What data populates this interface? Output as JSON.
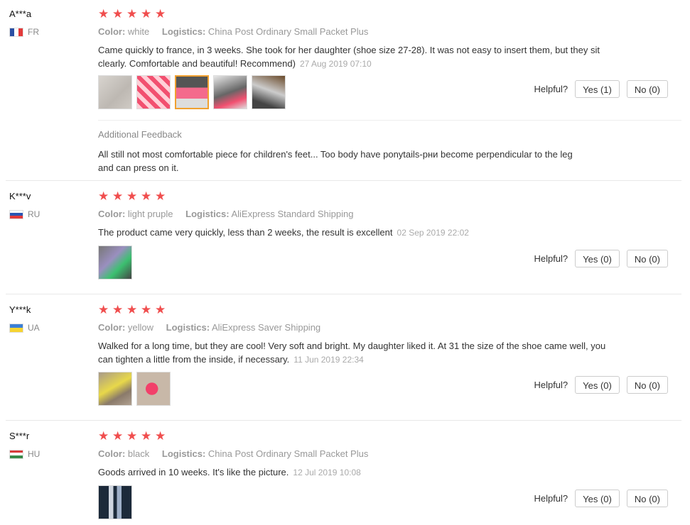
{
  "colors": {
    "star": "#f04e4e",
    "selected_thumb_border": "#f0a030"
  },
  "helpful_label": "Helpful?",
  "color_label": "Color:",
  "logistics_label": "Logistics:",
  "reviews": [
    {
      "user": "A***a",
      "country": "FR",
      "rating": 5,
      "color": "white",
      "logistics": "China Post Ordinary Small Packet Plus",
      "text": "Came quickly to france, in 3 weeks. She took for her daughter (shoe size 27-28). It was not easy to insert them, but they sit clearly. Comfortable and beautiful! Recommend)",
      "date": "27 Aug 2019 07:10",
      "photos": 5,
      "yes": "Yes (1)",
      "no": "No (0)",
      "additional_title": "Additional Feedback",
      "additional_text": "All still not most comfortable piece for children's feet... Too body have ponytails-рни become perpendicular to the leg and can press on it."
    },
    {
      "user": "K***v",
      "country": "RU",
      "rating": 5,
      "color": "light pruple",
      "logistics": "AliExpress Standard Shipping",
      "text": "The product came very quickly, less than 2 weeks, the result is excellent",
      "date": "02 Sep 2019 22:02",
      "photos": 1,
      "yes": "Yes (0)",
      "no": "No (0)"
    },
    {
      "user": "Y***k",
      "country": "UA",
      "rating": 5,
      "color": "yellow",
      "logistics": "AliExpress Saver Shipping",
      "text": "Walked for a long time, but they are cool! Very soft and bright. My daughter liked it. At 31 the size of the shoe came well, you can tighten a little from the inside, if necessary.",
      "date": "11 Jun 2019 22:34",
      "photos": 2,
      "yes": "Yes (0)",
      "no": "No (0)"
    },
    {
      "user": "S***r",
      "country": "HU",
      "rating": 5,
      "color": "black",
      "logistics": "China Post Ordinary Small Packet Plus",
      "text": "Goods arrived in 10 weeks. It's like the picture.",
      "date": "12 Jul 2019 10:08",
      "photos": 1,
      "yes": "Yes (0)",
      "no": "No (0)"
    }
  ]
}
